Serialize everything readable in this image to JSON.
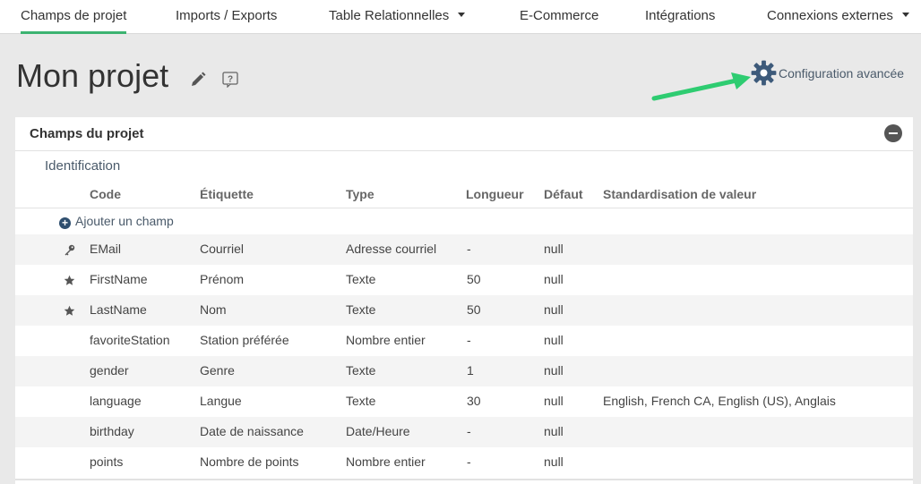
{
  "nav": {
    "tabs": [
      {
        "label": "Champs de projet",
        "active": true,
        "dropdown": false
      },
      {
        "label": "Imports / Exports",
        "active": false,
        "dropdown": false
      },
      {
        "label": "Table Relationnelles",
        "active": false,
        "dropdown": true
      },
      {
        "label": "E-Commerce",
        "active": false,
        "dropdown": false
      },
      {
        "label": "Intégrations",
        "active": false,
        "dropdown": false
      },
      {
        "label": "Connexions externes",
        "active": false,
        "dropdown": true
      }
    ]
  },
  "header": {
    "title": "Mon projet",
    "config_label": "Configuration avancée"
  },
  "panel": {
    "title": "Champs du projet",
    "section": "Identification",
    "columns": [
      "Code",
      "Étiquette",
      "Type",
      "Longueur",
      "Défaut",
      "Standardisation de valeur"
    ],
    "add_field_label": "Ajouter un champ",
    "rows": [
      {
        "icon": "key-icon",
        "code": "EMail",
        "label": "Courriel",
        "type": "Adresse courriel",
        "length": "-",
        "default": "null",
        "standard": ""
      },
      {
        "icon": "star-icon",
        "code": "FirstName",
        "label": "Prénom",
        "type": "Texte",
        "length": "50",
        "default": "null",
        "standard": ""
      },
      {
        "icon": "star-icon",
        "code": "LastName",
        "label": "Nom",
        "type": "Texte",
        "length": "50",
        "default": "null",
        "standard": ""
      },
      {
        "icon": "",
        "code": "favoriteStation",
        "label": "Station préférée",
        "type": "Nombre entier",
        "length": "-",
        "default": "null",
        "standard": ""
      },
      {
        "icon": "",
        "code": "gender",
        "label": "Genre",
        "type": "Texte",
        "length": "1",
        "default": "null",
        "standard": ""
      },
      {
        "icon": "",
        "code": "language",
        "label": "Langue",
        "type": "Texte",
        "length": "30",
        "default": "null",
        "standard": "English, French CA, English (US), Anglais"
      },
      {
        "icon": "",
        "code": "birthday",
        "label": "Date de naissance",
        "type": "Date/Heure",
        "length": "-",
        "default": "null",
        "standard": ""
      },
      {
        "icon": "",
        "code": "points",
        "label": "Nombre de points",
        "type": "Nombre entier",
        "length": "-",
        "default": "null",
        "standard": ""
      }
    ]
  },
  "colors": {
    "accent_green": "#3cb371",
    "gear": "#3d5a7a",
    "arrow": "#2ecc71"
  }
}
